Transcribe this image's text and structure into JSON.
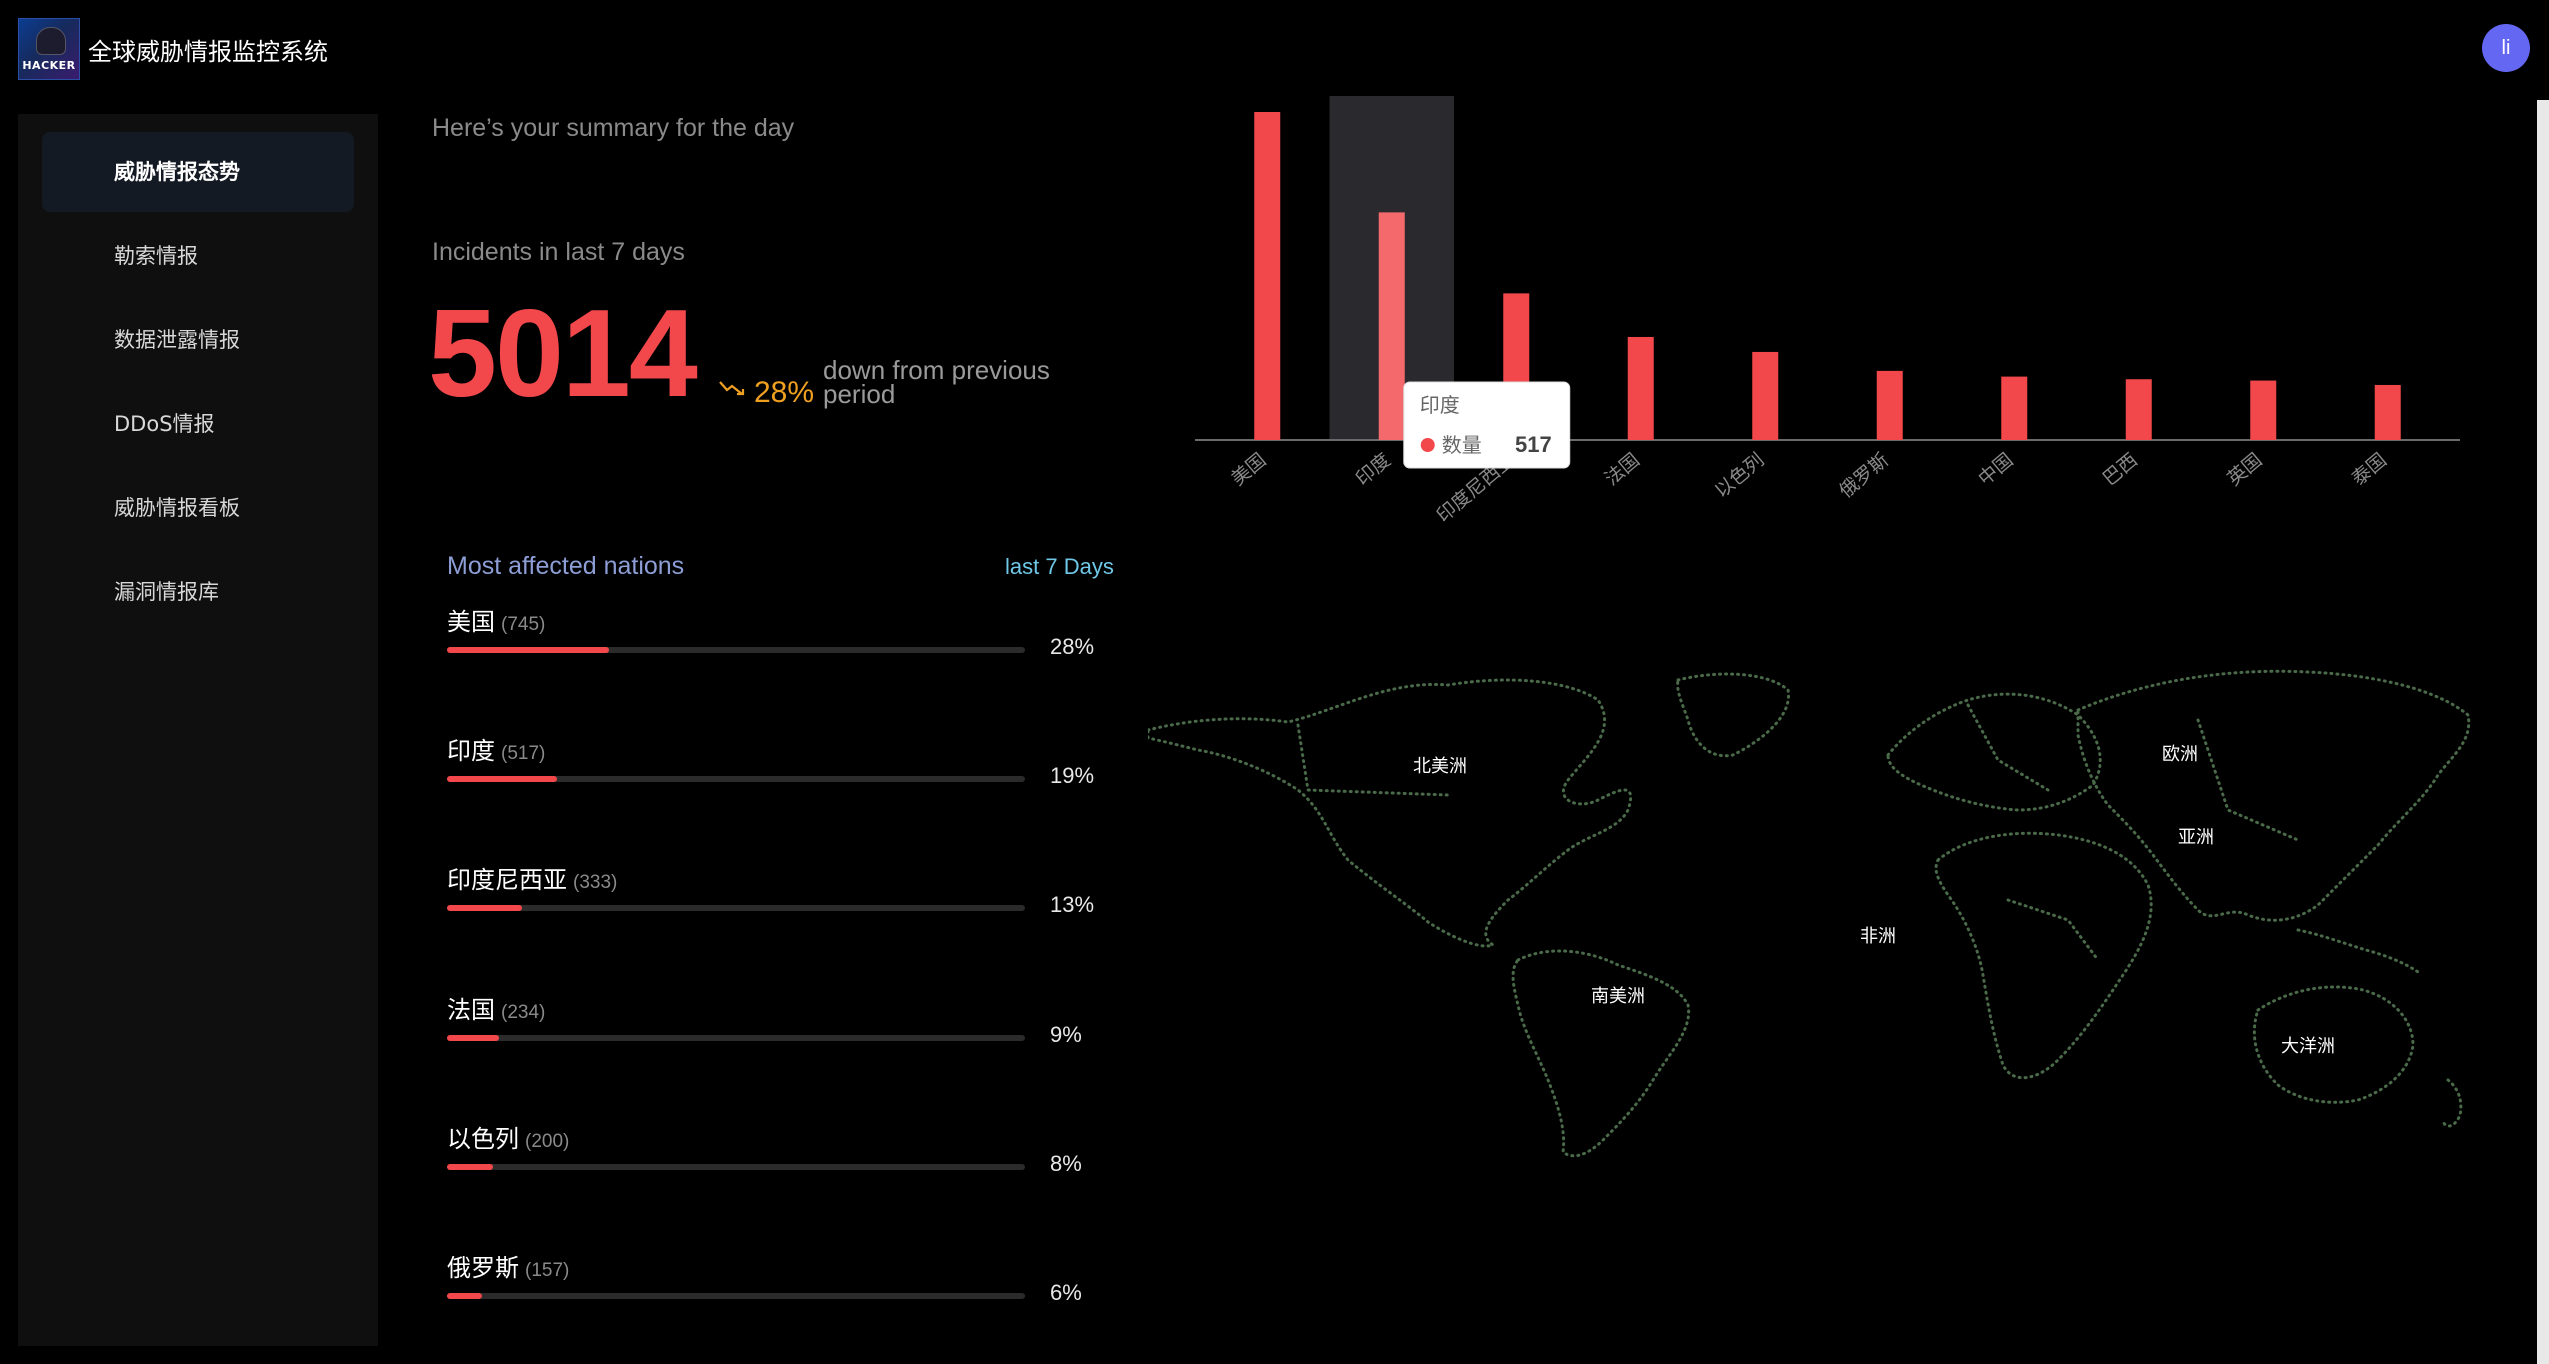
{
  "header": {
    "logo_text": "HACKER",
    "title": "全球威胁情报监控系统",
    "avatar_initial": "li"
  },
  "sidebar": {
    "items": [
      {
        "label": "威胁情报态势",
        "active": true
      },
      {
        "label": "勒索情报",
        "active": false
      },
      {
        "label": "数据泄露情报",
        "active": false
      },
      {
        "label": "DDoS情报",
        "active": false
      },
      {
        "label": "威胁情报看板",
        "active": false
      },
      {
        "label": "漏洞情报库",
        "active": false
      }
    ]
  },
  "summary": {
    "greeting": "Here’s your summary for the day",
    "incidents_label": "Incidents in last 7 days",
    "incidents_count": "5014",
    "trend_percent": "28%",
    "trend_note": "down from previous period",
    "trend_color": "#f0a020"
  },
  "nations": {
    "title": "Most affected nations",
    "period": "last 7 Days",
    "items": [
      {
        "name": "美国",
        "count": "(745)",
        "percent": "28%",
        "fraction": 0.28
      },
      {
        "name": "印度",
        "count": "(517)",
        "percent": "19%",
        "fraction": 0.19
      },
      {
        "name": "印度尼西亚",
        "count": "(333)",
        "percent": "13%",
        "fraction": 0.13
      },
      {
        "name": "法国",
        "count": "(234)",
        "percent": "9%",
        "fraction": 0.09
      },
      {
        "name": "以色列",
        "count": "(200)",
        "percent": "8%",
        "fraction": 0.08
      },
      {
        "name": "俄罗斯",
        "count": "(157)",
        "percent": "6%",
        "fraction": 0.06
      }
    ]
  },
  "chart_data": {
    "type": "bar",
    "categories": [
      "美国",
      "印度",
      "印度尼西亚",
      "法国",
      "以色列",
      "俄罗斯",
      "中国",
      "巴西",
      "英国",
      "泰国"
    ],
    "series": [
      {
        "name": "数量",
        "values": [
          745,
          517,
          333,
          234,
          200,
          157,
          144,
          138,
          135,
          125
        ]
      }
    ],
    "ylim": [
      0,
      745
    ],
    "bar_color": "#f2484b",
    "highlight_index": 1,
    "tooltip": {
      "title": "印度",
      "series_label": "数量",
      "value": "517"
    }
  },
  "map": {
    "continents": [
      "北美洲",
      "南美洲",
      "欧洲",
      "亚洲",
      "非洲",
      "大洋洲"
    ],
    "dot_color": "#4a6a4a"
  }
}
